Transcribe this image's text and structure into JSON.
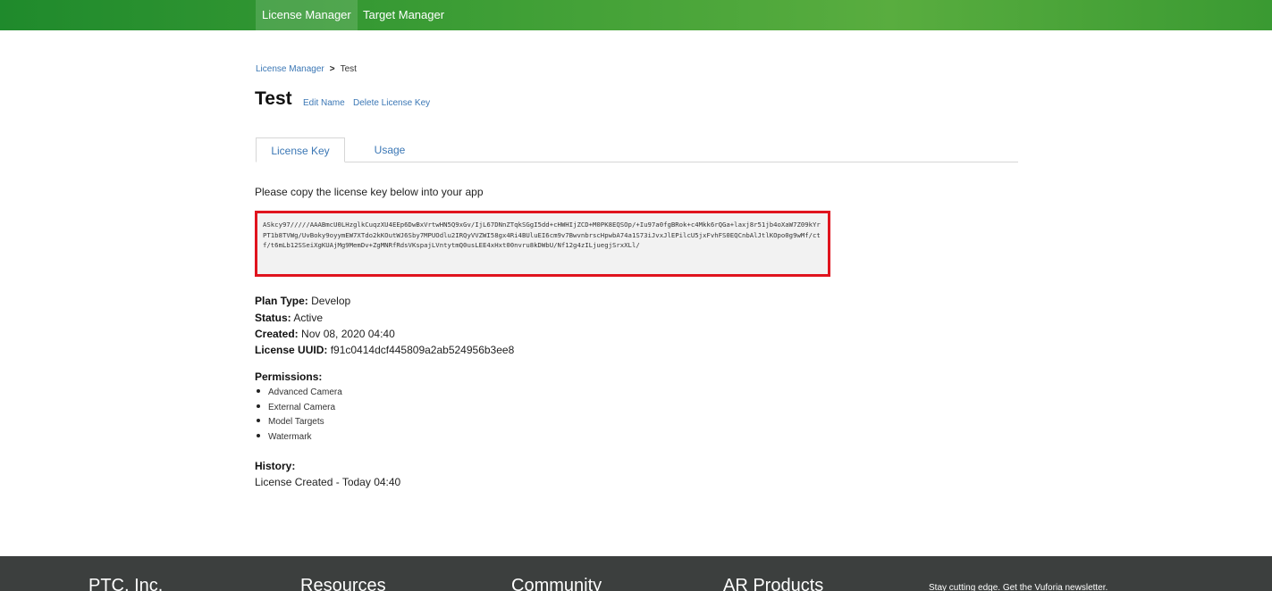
{
  "nav": {
    "items": [
      {
        "label": "License Manager",
        "active": true
      },
      {
        "label": "Target Manager",
        "active": false
      }
    ]
  },
  "breadcrumb": {
    "parent": "License Manager",
    "separator": ">",
    "current": "Test"
  },
  "page": {
    "title": "Test",
    "edit_name": "Edit Name",
    "delete_key": "Delete License Key"
  },
  "tabs": [
    {
      "label": "License Key",
      "active": true
    },
    {
      "label": "Usage",
      "active": false
    }
  ],
  "license": {
    "intro": "Please copy the license key below into your app",
    "key": "ASkcy97/////AAABmcU0LHzglkCuqzXU4EEp6DwBxVrtwHN5Q9xGv/IjL67DNnZTqkSGgI5dd+cHWHIjZCD+M0PK8EQSOp/+Iu97a0fgBRok+c4Mkk6rQGa+laxj8r51jb4oXaW7Z09kYrPT1b8TVWg/UvBoky9oyymEW7XTdo2kKOutWJ6Sby7MPUOdlu2IRQyVVZWI58gx4Ri4BUluEI6cm9v7BwvnbrscHpwbA74a1S73iJvxJlEPilcU5jxFvhFS0EQCnbAlJtlKOpo0g9wMf/ctf/t6mLb12SSeiXgKUAjMg9MemDv+ZgMNRfRdsVKspajLVntytmQ0usLEE4xHxt00nvru8kDWbU/Nf12g4zILjuegjSrxXLl/",
    "highlight_color": "#e0141e"
  },
  "details": {
    "plan_label": "Plan Type:",
    "plan_value": "Develop",
    "status_label": "Status:",
    "status_value": "Active",
    "created_label": "Created:",
    "created_value": "Nov 08, 2020 04:40",
    "uuid_label": "License UUID:",
    "uuid_value": "f91c0414dcf445809a2ab524956b3ee8"
  },
  "permissions": {
    "title": "Permissions:",
    "items": [
      "Advanced Camera",
      "External Camera",
      "Model Targets",
      "Watermark"
    ]
  },
  "history": {
    "title": "History:",
    "entry": "License Created - Today 04:40"
  },
  "footer": {
    "columns": [
      "PTC, Inc.",
      "Resources",
      "Community",
      "AR Products"
    ],
    "newsletter": "Stay cutting edge. Get the Vuforia newsletter."
  },
  "colors": {
    "nav_green": "#3f9f36",
    "link_blue": "#3b77b5",
    "footer_bg": "#3c3f3e"
  }
}
